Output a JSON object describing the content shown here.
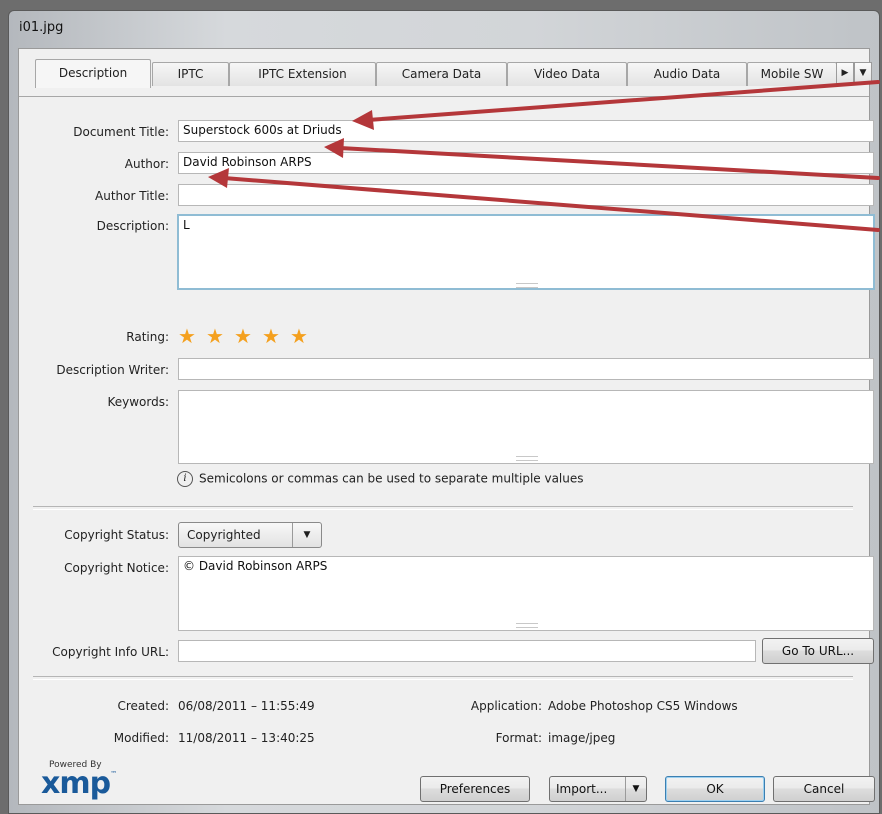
{
  "window": {
    "title": "i01.jpg"
  },
  "tabs": [
    {
      "label": "Description"
    },
    {
      "label": "IPTC"
    },
    {
      "label": "IPTC Extension"
    },
    {
      "label": "Camera Data"
    },
    {
      "label": "Video Data"
    },
    {
      "label": "Audio Data"
    },
    {
      "label": "Mobile SW"
    }
  ],
  "tab_scroll": {
    "right": "▶",
    "menu": "▼"
  },
  "form": {
    "document_title": {
      "label": "Document Title:",
      "value": "Superstock 600s at Driuds"
    },
    "author": {
      "label": "Author:",
      "value": "David Robinson ARPS"
    },
    "author_title": {
      "label": "Author Title:",
      "value": ""
    },
    "description": {
      "label": "Description:",
      "value": "L"
    },
    "rating": {
      "label": "Rating:",
      "stars": 5,
      "star_color": "#f4a01e"
    },
    "description_writer": {
      "label": "Description Writer:",
      "value": ""
    },
    "keywords": {
      "label": "Keywords:",
      "value": ""
    },
    "hint": "Semicolons or commas can be used to separate multiple values",
    "hint_icon": "info-icon"
  },
  "copyright": {
    "status_label": "Copyright Status:",
    "status_value": "Copyrighted",
    "notice_label": "Copyright Notice:",
    "notice_value": "© David Robinson ARPS",
    "url_label": "Copyright Info URL:",
    "url_value": "",
    "goto_button": "Go To URL..."
  },
  "meta": {
    "created_label": "Created:",
    "created_value": "06/08/2011 – 11:55:49",
    "modified_label": "Modified:",
    "modified_value": "11/08/2011 – 13:40:25",
    "application_label": "Application:",
    "application_value": "Adobe Photoshop CS5 Windows",
    "format_label": "Format:",
    "format_value": "image/jpeg"
  },
  "footer": {
    "powered_by": "Powered By",
    "logo_text": "xmp",
    "logo_tm": "™",
    "preferences": "Preferences",
    "import": "Import...",
    "ok": "OK",
    "cancel": "Cancel"
  },
  "colors": {
    "annotation_arrow": "#b4373a",
    "focus_border": "#8fbcd4",
    "default_button": "#3c7fb1"
  }
}
